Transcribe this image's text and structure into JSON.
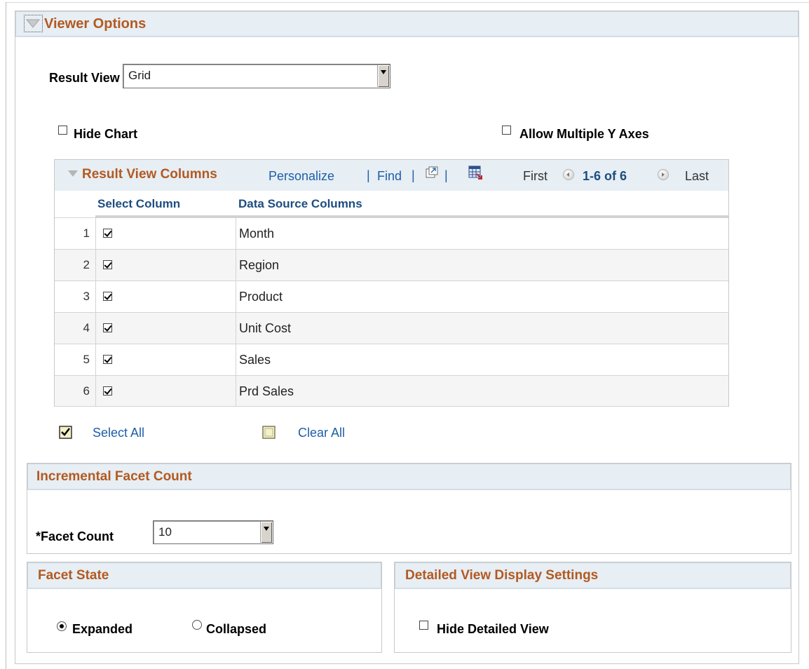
{
  "viewer_options": {
    "title": "Viewer Options",
    "result_view_label": "Result View",
    "result_view_value": "Grid",
    "hide_chart_label": "Hide Chart",
    "hide_chart_checked": false,
    "allow_multi_y_label": "Allow Multiple Y Axes",
    "allow_multi_y_checked": false
  },
  "grid": {
    "title": "Result View Columns",
    "personalize": "Personalize",
    "find": "Find",
    "sep": "|",
    "first": "First",
    "range": "1-6 of 6",
    "last": "Last",
    "col_select": "Select Column",
    "col_source": "Data Source Columns",
    "rows": [
      {
        "num": "1",
        "checked": true,
        "name": "Month"
      },
      {
        "num": "2",
        "checked": true,
        "name": "Region"
      },
      {
        "num": "3",
        "checked": true,
        "name": "Product"
      },
      {
        "num": "4",
        "checked": true,
        "name": "Unit Cost"
      },
      {
        "num": "5",
        "checked": true,
        "name": "Sales"
      },
      {
        "num": "6",
        "checked": true,
        "name": "Prd Sales"
      }
    ]
  },
  "actions": {
    "select_all": "Select All",
    "clear_all": "Clear All"
  },
  "facet_count": {
    "title": "Incremental Facet Count",
    "label": "*Facet Count",
    "value": "10"
  },
  "facet_state": {
    "title": "Facet State",
    "expanded": "Expanded",
    "collapsed": "Collapsed",
    "selected": "Expanded"
  },
  "detailed_view": {
    "title": "Detailed View Display Settings",
    "hide_label": "Hide Detailed View",
    "hide_checked": false
  },
  "colors": {
    "section_title": "#b35920",
    "header_bg": "#e7eef4",
    "link": "#1d5fa8"
  }
}
